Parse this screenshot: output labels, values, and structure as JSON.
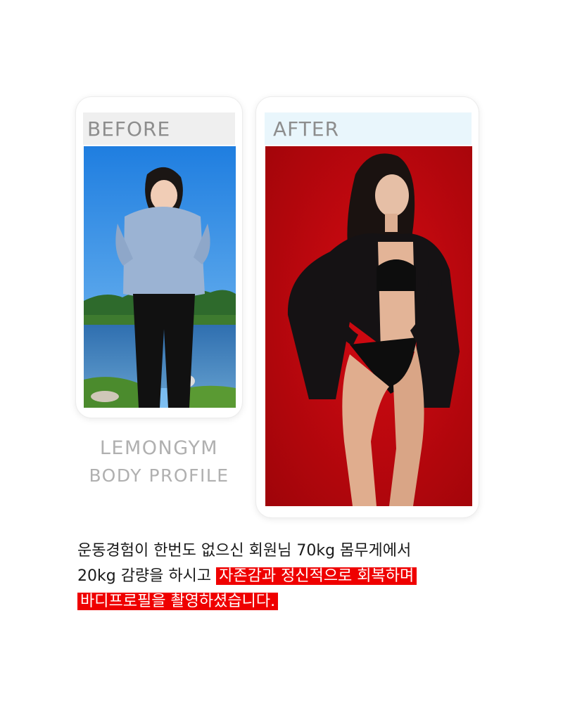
{
  "before": {
    "label": "BEFORE"
  },
  "after": {
    "label": "AFTER"
  },
  "brand": {
    "name": "LEMONGYM",
    "subtitle": "BODY PROFILE"
  },
  "caption": {
    "line1": "운동경험이 한번도 없으신 회원님 70kg 몸무게에서",
    "line2_plain": "20kg 감량을 하시고",
    "line2_highlight": "자존감과 정신적으로 회복하며",
    "line3_highlight": "바디프로필을 촬영하셨습니다."
  },
  "colors": {
    "highlight": "#ef0000",
    "before_bar": "#efefef",
    "after_bar": "#e9f6fc",
    "after_backdrop": "#c4060d",
    "label_text": "#8d8d8d"
  }
}
